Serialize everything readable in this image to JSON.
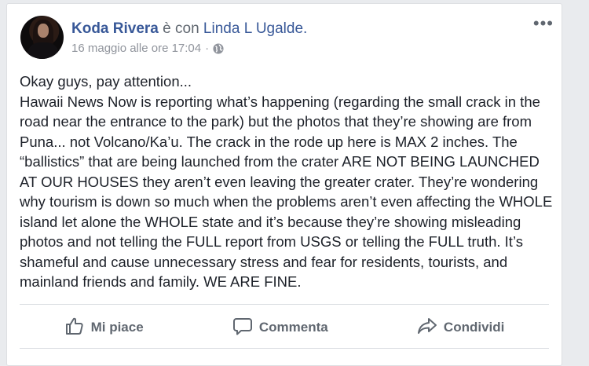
{
  "post": {
    "author": "Koda Rivera",
    "with_text": " è con ",
    "tagged": "Linda L Ugalde.",
    "timestamp": "16 maggio alle ore 17:04",
    "separator": "·",
    "privacy_icon": "globe-icon",
    "menu_icon": "more-options-icon",
    "more_glyph": "•••",
    "paragraphs": [
      "Okay guys, pay attention...",
      "Hawaii News Now is reporting what’s happening (regarding the small crack in the road near the entrance to the park) but the photos that they’re showing are from Puna... not Volcano/Ka’u. The crack in the rode up here is MAX 2 inches. The “ballistics” that are being launched from the crater ARE NOT BEING LAUNCHED AT OUR HOUSES they aren’t even leaving the greater crater. They’re wondering why tourism is down so much when the problems aren’t even affecting the WHOLE island let alone the WHOLE state and it’s because they’re showing misleading photos and not telling the FULL report from USGS or telling the FULL truth. It’s shameful and cause unnecessary stress and fear for residents, tourists, and mainland friends and family. WE ARE FINE."
    ]
  },
  "actions": {
    "like": {
      "label": "Mi piace",
      "icon": "thumbs-up-icon"
    },
    "comment": {
      "label": "Commenta",
      "icon": "comment-icon"
    },
    "share": {
      "label": "Condividi",
      "icon": "share-icon"
    }
  },
  "colors": {
    "link": "#385898",
    "text": "#1d2129",
    "muted": "#90949c",
    "action": "#606770"
  }
}
